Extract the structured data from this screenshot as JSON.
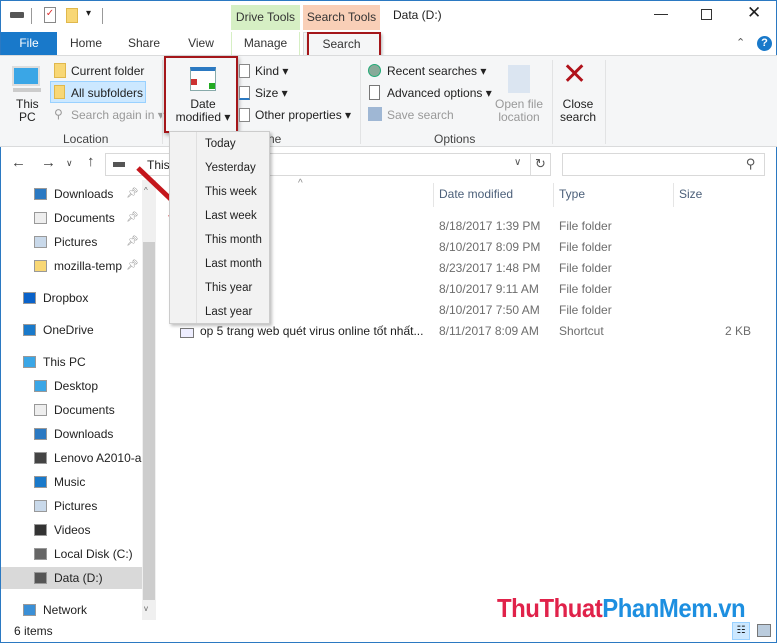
{
  "window": {
    "title": "Data (D:)"
  },
  "context_tabs": {
    "drive_tools": "Drive Tools",
    "search_tools": "Search Tools"
  },
  "tabs": {
    "file": "File",
    "home": "Home",
    "share": "Share",
    "view": "View",
    "manage": "Manage",
    "search": "Search"
  },
  "ribbon": {
    "location": {
      "this_pc": "This\nPC",
      "this_pc_l1": "This",
      "this_pc_l2": "PC",
      "current_folder": "Current folder",
      "all_subfolders": "All subfolders",
      "search_again_in": "Search again in",
      "label": "Location"
    },
    "refine": {
      "date_l1": "Date",
      "date_l2": "modified",
      "kind": "Kind",
      "size": "Size",
      "other_properties": "Other properties",
      "label_partial": "ne"
    },
    "options": {
      "recent_searches": "Recent searches",
      "advanced_options": "Advanced options",
      "save_search": "Save search",
      "open_l1": "Open file",
      "open_l2": "location",
      "label": "Options"
    },
    "close": {
      "l1": "Close",
      "l2": "search"
    }
  },
  "address": {
    "path_partial": "This"
  },
  "date_menu": [
    "Today",
    "Yesterday",
    "This week",
    "Last week",
    "This month",
    "Last month",
    "This year",
    "Last year"
  ],
  "nav": [
    {
      "label": "Downloads",
      "pinned": true
    },
    {
      "label": "Documents",
      "pinned": true
    },
    {
      "label": "Pictures",
      "pinned": true
    },
    {
      "label": "mozilla-temp",
      "pinned": true
    },
    {
      "label": "Dropbox"
    },
    {
      "label": "OneDrive"
    },
    {
      "label": "This PC"
    },
    {
      "label": "Desktop"
    },
    {
      "label": "Documents"
    },
    {
      "label": "Downloads"
    },
    {
      "label": "Lenovo A2010-a"
    },
    {
      "label": "Music"
    },
    {
      "label": "Pictures"
    },
    {
      "label": "Videos"
    },
    {
      "label": "Local Disk (C:)"
    },
    {
      "label": "Data (D:)",
      "selected": true
    },
    {
      "label": "Network"
    }
  ],
  "columns": {
    "date": "Date modified",
    "type": "Type",
    "size": "Size"
  },
  "files": [
    {
      "name": "r",
      "date": "8/18/2017 1:39 PM",
      "type": "File folder",
      "size": ""
    },
    {
      "name": "",
      "date": "8/10/2017 8:09 PM",
      "type": "File folder",
      "size": ""
    },
    {
      "name": "",
      "date": "8/23/2017 1:48 PM",
      "type": "File folder",
      "size": ""
    },
    {
      "name": "",
      "date": "8/10/2017 9:11 AM",
      "type": "File folder",
      "size": ""
    },
    {
      "name": "",
      "date": "8/10/2017 7:50 AM",
      "type": "File folder",
      "size": ""
    },
    {
      "name": "op 5 trang web quét virus online tốt nhất...",
      "date": "8/11/2017 8:09 AM",
      "type": "Shortcut",
      "size": "2 KB"
    }
  ],
  "status": {
    "items": "6 items"
  },
  "watermark": "ThuThuatPhanMem.vn",
  "colors": {
    "accent": "#1979ca",
    "drive_tools": "#d6efc4",
    "search_tools": "#f9cfb7",
    "highlight_box": "#a4161a",
    "selected_nav": "#cce8ff"
  }
}
